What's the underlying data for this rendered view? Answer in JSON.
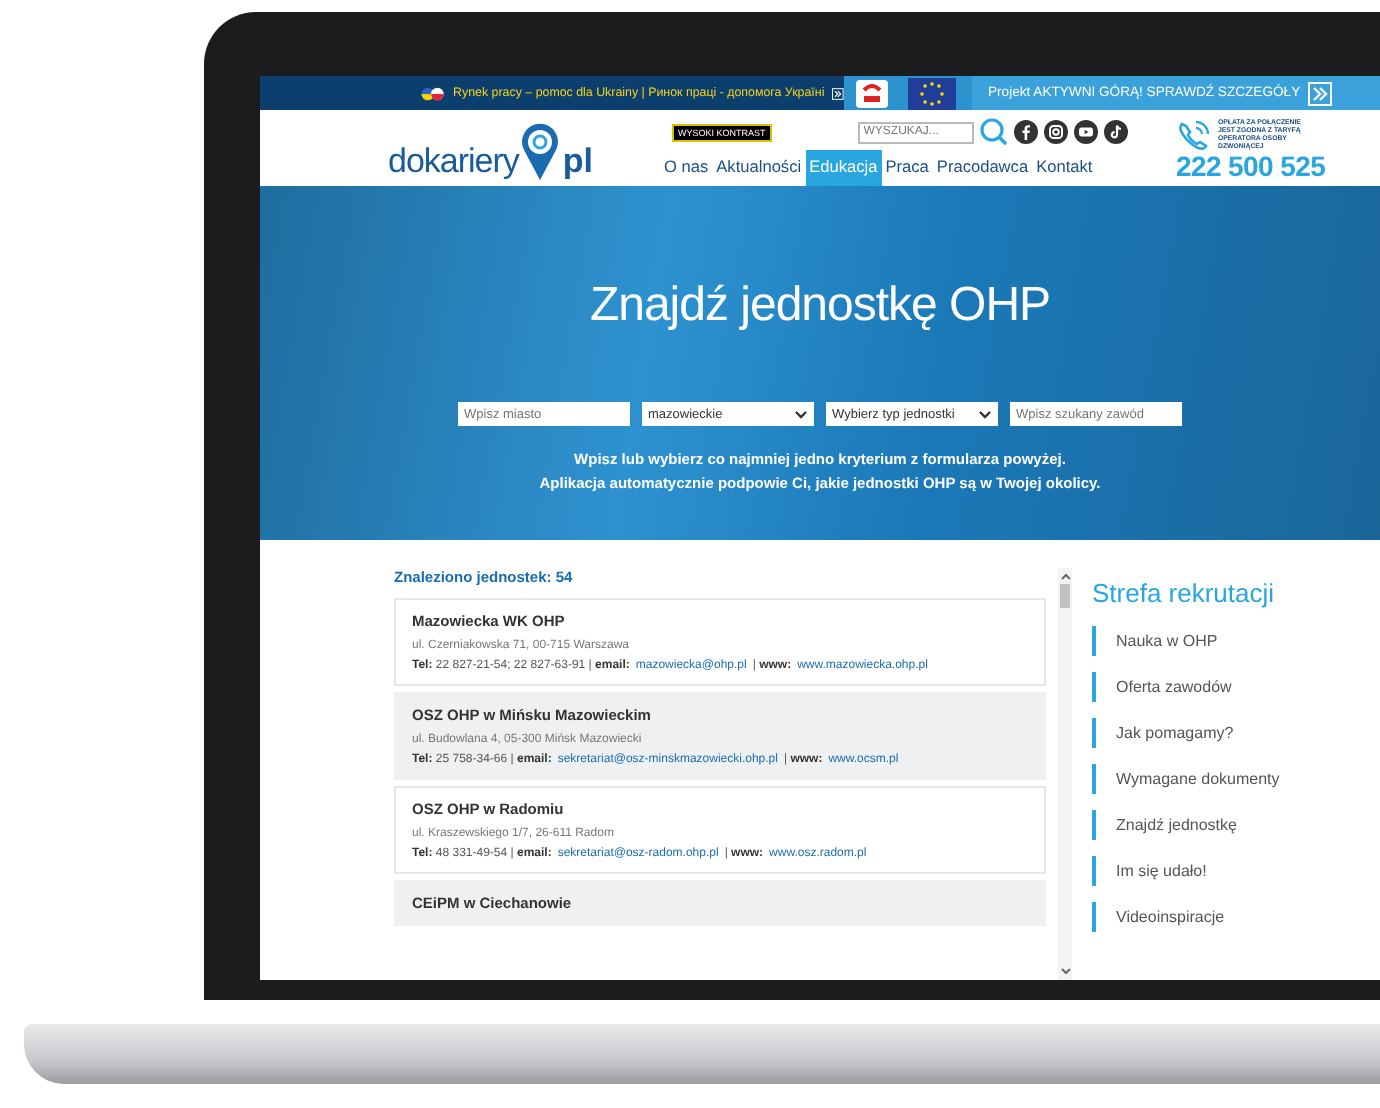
{
  "top_bar": {
    "ukraine_text": "Rynek pracy – pomoc dla Ukrainy | Ринок праці - допомога Україні",
    "project_text": "Projekt AKTYWNI GÓRĄ!  SPRAWDŹ SZCZEGÓŁY"
  },
  "header": {
    "logo": {
      "name": "dokariery",
      "suffix": "pl"
    },
    "contrast_button": "WYSOKI KONTRAST",
    "search": {
      "placeholder": "WYSZUKAJ..."
    },
    "nav": [
      {
        "label": "O nas",
        "selected": false
      },
      {
        "label": "Aktualności",
        "selected": false
      },
      {
        "label": "Edukacja",
        "selected": true
      },
      {
        "label": "Praca",
        "selected": false
      },
      {
        "label": "Pracodawca",
        "selected": false
      },
      {
        "label": "Kontakt",
        "selected": false
      }
    ],
    "hotline": {
      "note": "OPŁATA ZA POŁĄCZENIE JEST ZGODNA Z TARYFĄ OPERATORA OSOBY DZWONIĄCEJ",
      "number": "222 500 525"
    }
  },
  "hero": {
    "title": "Znajdź jednostkę OHP",
    "filters": [
      {
        "kind": "input",
        "placeholder": "Wpisz miasto"
      },
      {
        "kind": "select",
        "value": "mazowieckie"
      },
      {
        "kind": "select",
        "value": "Wybierz typ jednostki"
      },
      {
        "kind": "input",
        "placeholder": "Wpisz szukany zawód"
      }
    ],
    "hint_lines": [
      "Wpisz lub wybierz co najmniej jedno kryterium z formularza powyżej.",
      "Aplikacja automatycznie podpowie Ci, jakie jednostki OHP są w Twojej okolicy."
    ]
  },
  "results": {
    "count": "Znaleziono jednostek: 54",
    "units": [
      {
        "name": "Mazowiecka WK OHP",
        "address": "ul. Czerniakowska 71, 00-715 Warszawa",
        "tel": "**Tel:** 22 827-21-54; 22 827-63-91 | **email:**",
        "email": "mazowiecka@ohp.pl",
        "www_label": "| **www:**",
        "www": "www.mazowiecka.ohp.pl"
      },
      {
        "name": "OSZ OHP w Mińsku Mazowieckim",
        "address": "ul. Budowlana 4, 05-300 Mińsk Mazowiecki",
        "tel": "**Tel:** 25 758-34-66 | **email:**",
        "email": "sekretariat@osz-minskmazowiecki.ohp.pl",
        "www_label": "| **www:**",
        "www": "www.ocsm.pl"
      },
      {
        "name": "OSZ OHP w Radomiu",
        "address": "ul. Kraszewskiego 1/7, 26-611 Radom",
        "tel": "**Tel:** 48 331-49-54 | **email:**",
        "email": "sekretariat@osz-radom.ohp.pl",
        "www_label": "| **www:**",
        "www": "www.osz.radom.pl"
      },
      {
        "name": "CEiPM w Ciechanowie"
      }
    ]
  },
  "sidebar": {
    "title": "Strefa rekrutacji",
    "items": [
      "Nauka w OHP",
      "Oferta zawodów",
      "Jak pomagamy?",
      "Wymagane dokumenty",
      "Znajdź jednostkę",
      "Im się udało!",
      "Videoinspiracje"
    ]
  }
}
